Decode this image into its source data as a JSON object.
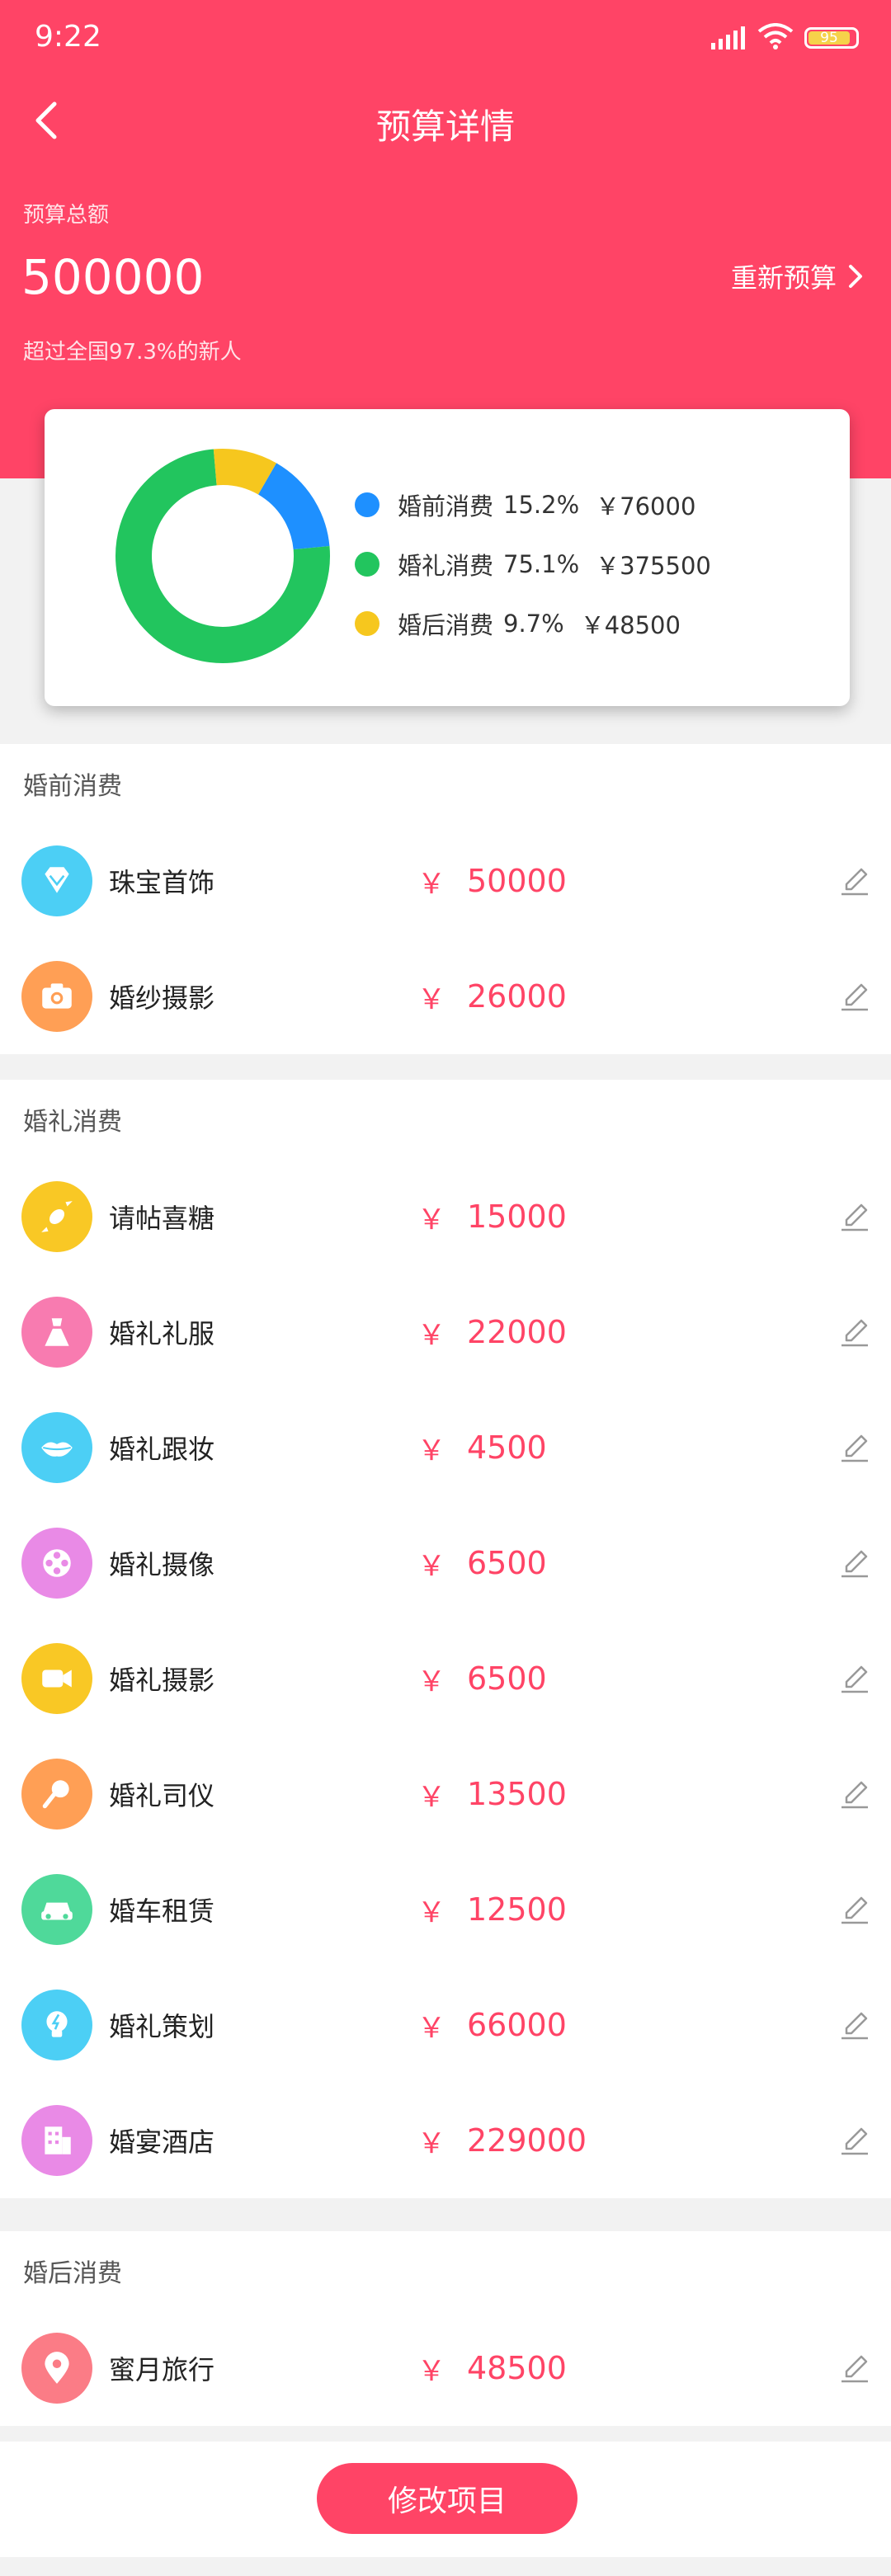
{
  "status_bar": {
    "time": "9:22",
    "battery": "95"
  },
  "nav": {
    "title": "预算详情"
  },
  "budget": {
    "label": "预算总额",
    "total": "500000",
    "rebudget_label": "重新预算",
    "rank_text": "超过全国97.3%的新人"
  },
  "chart_data": {
    "type": "pie",
    "style": "donut",
    "slices": [
      {
        "name": "婚前消费",
        "percent": 15.2,
        "value": 76000,
        "color": "#1e90ff"
      },
      {
        "name": "婚礼消费",
        "percent": 75.1,
        "value": 375500,
        "color": "#22c55e"
      },
      {
        "name": "婚后消费",
        "percent": 9.7,
        "value": 48500,
        "color": "#f6c71e"
      }
    ],
    "legend": [
      {
        "name": "婚前消费",
        "pct": "15.2%",
        "amt": "￥76000"
      },
      {
        "name": "婚礼消费",
        "pct": "75.1%",
        "amt": "￥375500"
      },
      {
        "name": "婚后消费",
        "pct": "9.7%",
        "amt": "￥48500"
      }
    ]
  },
  "currency_symbol": "￥",
  "sections": [
    {
      "title": "婚前消费",
      "items": [
        {
          "name": "珠宝首饰",
          "amount": "50000",
          "icon": "diamond-icon",
          "color": "#4ccff5"
        },
        {
          "name": "婚纱摄影",
          "amount": "26000",
          "icon": "camera-icon",
          "color": "#ff9f55"
        }
      ]
    },
    {
      "title": "婚礼消费",
      "items": [
        {
          "name": "请帖喜糖",
          "amount": "15000",
          "icon": "candy-icon",
          "color": "#f9c825"
        },
        {
          "name": "婚礼礼服",
          "amount": "22000",
          "icon": "dress-icon",
          "color": "#f87bb0"
        },
        {
          "name": "婚礼跟妆",
          "amount": "4500",
          "icon": "lips-icon",
          "color": "#4ccff5"
        },
        {
          "name": "婚礼摄像",
          "amount": "6500",
          "icon": "film-reel-icon",
          "color": "#e98ae6"
        },
        {
          "name": "婚礼摄影",
          "amount": "6500",
          "icon": "video-camera-icon",
          "color": "#f9c825"
        },
        {
          "name": "婚礼司仪",
          "amount": "13500",
          "icon": "microphone-icon",
          "color": "#ff9f55"
        },
        {
          "name": "婚车租赁",
          "amount": "12500",
          "icon": "car-icon",
          "color": "#4fd99a"
        },
        {
          "name": "婚礼策划",
          "amount": "66000",
          "icon": "lightbulb-icon",
          "color": "#4ccff5"
        },
        {
          "name": "婚宴酒店",
          "amount": "229000",
          "icon": "hotel-icon",
          "color": "#e98ae6"
        }
      ]
    },
    {
      "title": "婚后消费",
      "items": [
        {
          "name": "蜜月旅行",
          "amount": "48500",
          "icon": "location-pin-icon",
          "color": "#fb7c86"
        }
      ]
    }
  ],
  "footer": {
    "modify_label": "修改项目"
  }
}
